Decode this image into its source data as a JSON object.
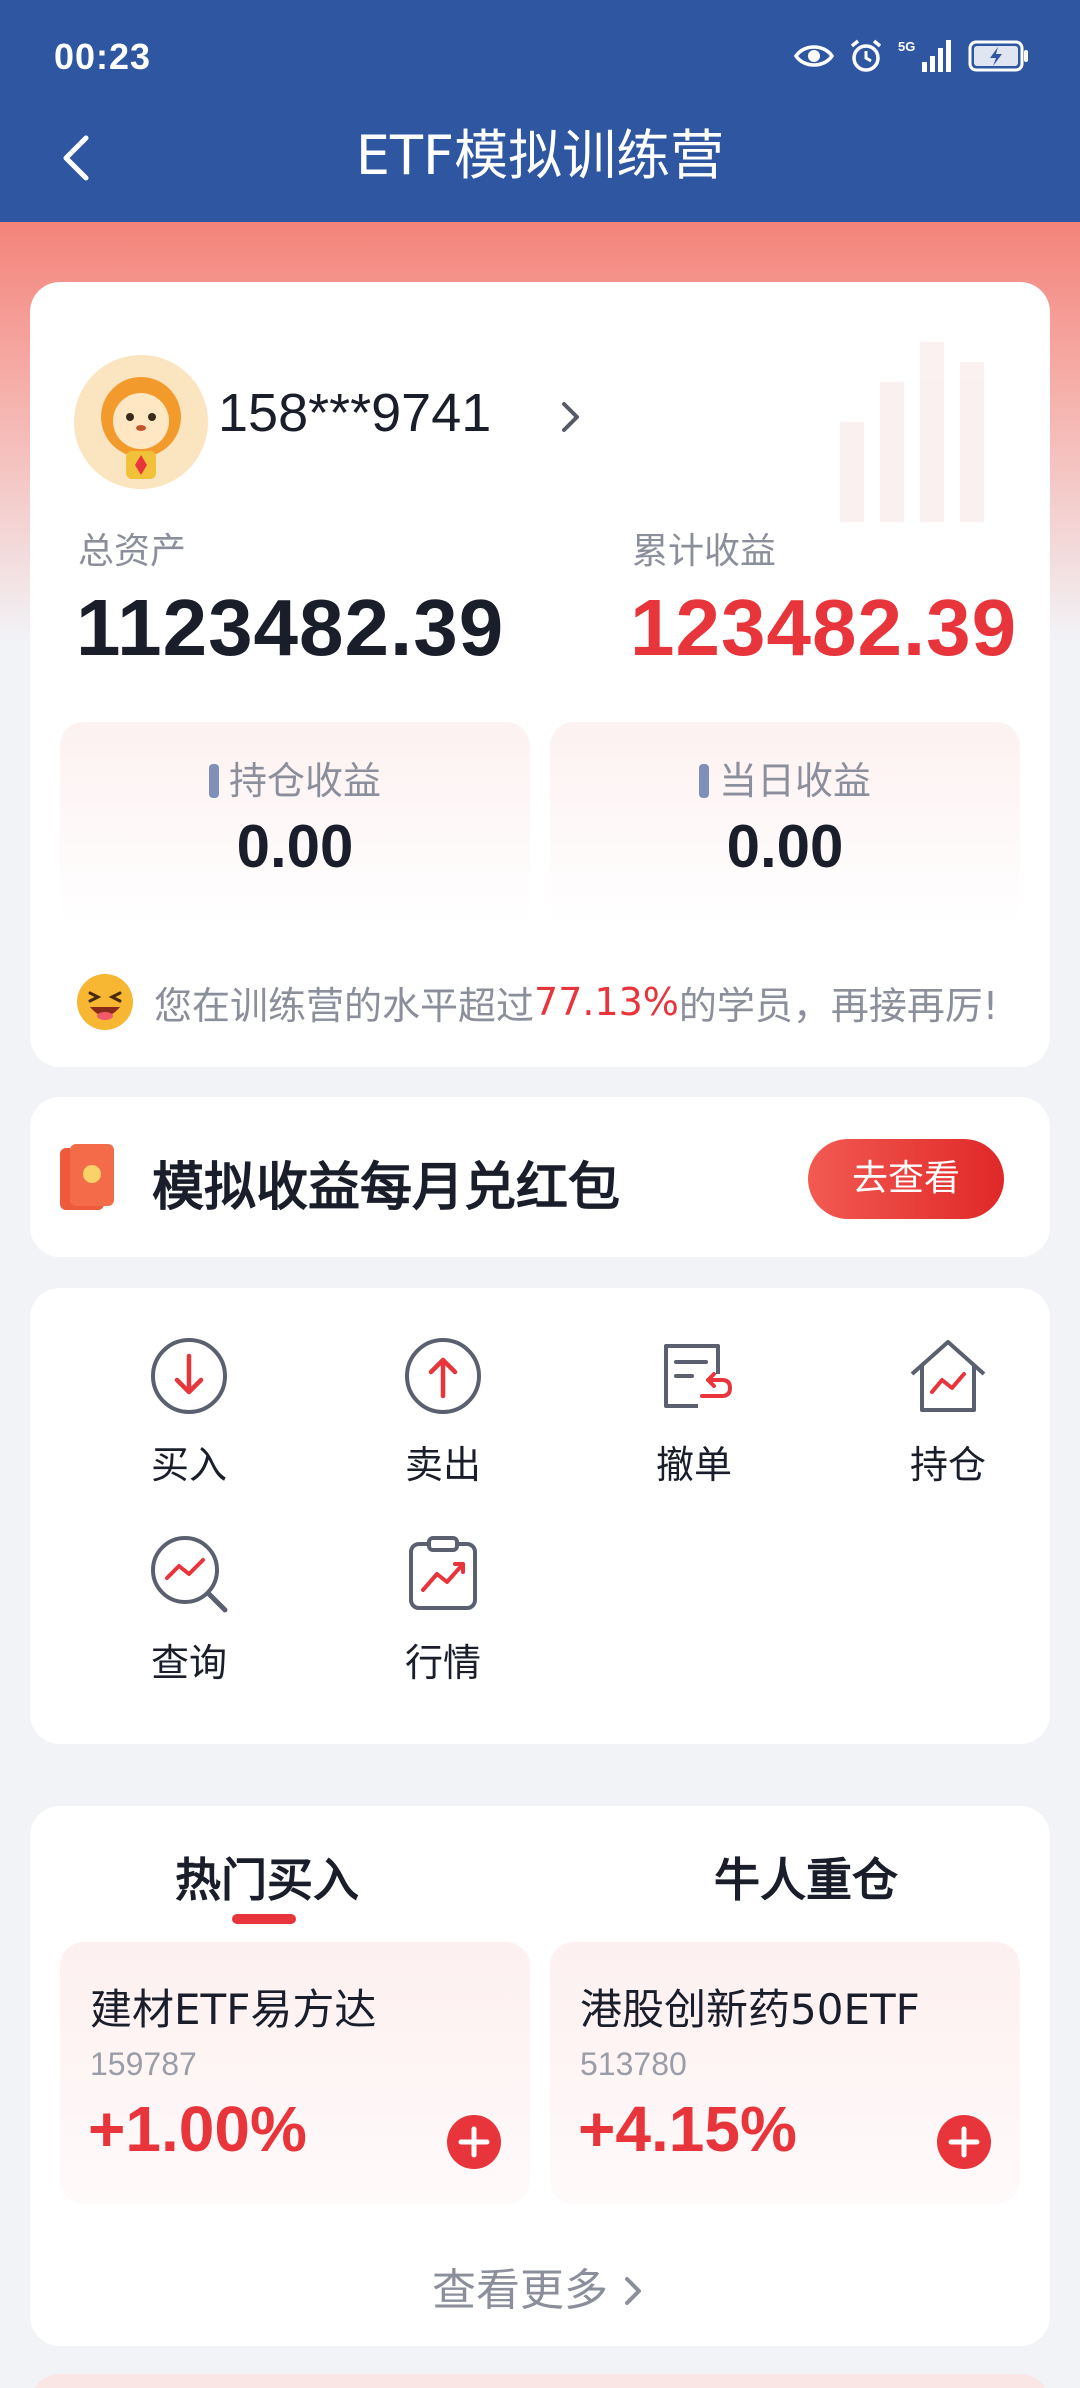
{
  "status_bar": {
    "time": "00:23",
    "network": "5G"
  },
  "header": {
    "title": "ETF模拟训练营"
  },
  "account": {
    "phone": "158***9741",
    "total_assets_label": "总资产",
    "total_assets_value": "1123482.39",
    "cumulative_label": "累计收益",
    "cumulative_value": "123482.39",
    "holding_label": "持仓收益",
    "holding_value": "0.00",
    "daily_label": "当日收益",
    "daily_value": "0.00",
    "rank_prefix": "您在训练营的水平超过",
    "rank_pct": "77.13%",
    "rank_suffix": "的学员，再接再厉!"
  },
  "promo": {
    "text": "模拟收益每月兑红包",
    "button": "去查看"
  },
  "functions": [
    {
      "label": "买入",
      "icon": "buy-icon"
    },
    {
      "label": "卖出",
      "icon": "sell-icon"
    },
    {
      "label": "撤单",
      "icon": "cancel-order-icon"
    },
    {
      "label": "持仓",
      "icon": "holdings-icon"
    },
    {
      "label": "查询",
      "icon": "query-icon"
    },
    {
      "label": "行情",
      "icon": "market-icon"
    }
  ],
  "tabs": [
    {
      "label": "热门买入",
      "active": true
    },
    {
      "label": "牛人重仓",
      "active": false
    }
  ],
  "funds": [
    {
      "name": "建材ETF易方达",
      "code": "159787",
      "change": "+1.00%"
    },
    {
      "name": "港股创新药50ETF",
      "code": "513780",
      "change": "+4.15%"
    }
  ],
  "more": "查看更多",
  "colors": {
    "header_bg": "#2f56a0",
    "accent_red": "#e8343b"
  }
}
